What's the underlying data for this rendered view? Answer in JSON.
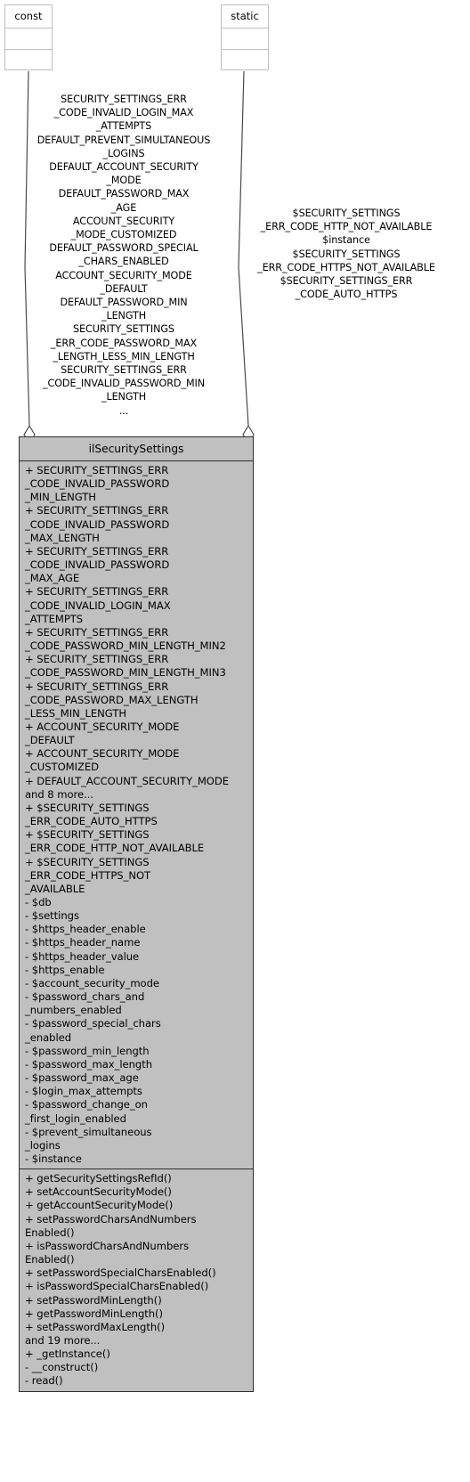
{
  "diagram": {
    "type": "uml-class-diagram",
    "background_color": "#ffffff",
    "class_fill_color": "#c0c0c0",
    "class_border_color": "#2e2e2e",
    "stereotype_box_fill": "#ffffff",
    "stereotype_box_border": "#bfbfbf",
    "edge_color": "#4a4a4a",
    "relationship": "aggregation"
  },
  "stereotype_boxes": [
    {
      "id": "const",
      "title": "const"
    },
    {
      "id": "static",
      "title": "static"
    }
  ],
  "edge_labels": {
    "const": "SECURITY_SETTINGS_ERR\n_CODE_INVALID_LOGIN_MAX\n_ATTEMPTS\nDEFAULT_PREVENT_SIMULTANEOUS\n_LOGINS\nDEFAULT_ACCOUNT_SECURITY\n_MODE\nDEFAULT_PASSWORD_MAX\n_AGE\nACCOUNT_SECURITY\n_MODE_CUSTOMIZED\nDEFAULT_PASSWORD_SPECIAL\n_CHARS_ENABLED\nACCOUNT_SECURITY_MODE\n_DEFAULT\nDEFAULT_PASSWORD_MIN\n_LENGTH\nSECURITY_SETTINGS\n_ERR_CODE_PASSWORD_MAX\n_LENGTH_LESS_MIN_LENGTH\nSECURITY_SETTINGS_ERR\n_CODE_INVALID_PASSWORD_MIN\n_LENGTH\n...",
    "static": "$SECURITY_SETTINGS\n_ERR_CODE_HTTP_NOT_AVAILABLE\n$instance\n$SECURITY_SETTINGS\n_ERR_CODE_HTTPS_NOT_AVAILABLE\n$SECURITY_SETTINGS_ERR\n_CODE_AUTO_HTTPS"
  },
  "main_class": {
    "name": "ilSecuritySettings",
    "attributes": [
      "+ SECURITY_SETTINGS_ERR\n_CODE_INVALID_PASSWORD\n_MIN_LENGTH",
      "+ SECURITY_SETTINGS_ERR\n_CODE_INVALID_PASSWORD\n_MAX_LENGTH",
      "+ SECURITY_SETTINGS_ERR\n_CODE_INVALID_PASSWORD\n_MAX_AGE",
      "+ SECURITY_SETTINGS_ERR\n_CODE_INVALID_LOGIN_MAX\n_ATTEMPTS",
      "+ SECURITY_SETTINGS_ERR\n_CODE_PASSWORD_MIN_LENGTH_MIN2",
      "+ SECURITY_SETTINGS_ERR\n_CODE_PASSWORD_MIN_LENGTH_MIN3",
      "+ SECURITY_SETTINGS_ERR\n_CODE_PASSWORD_MAX_LENGTH\n_LESS_MIN_LENGTH",
      "+ ACCOUNT_SECURITY_MODE\n_DEFAULT",
      "+ ACCOUNT_SECURITY_MODE\n_CUSTOMIZED",
      "+ DEFAULT_ACCOUNT_SECURITY_MODE",
      "and 8 more...",
      "+ $SECURITY_SETTINGS\n_ERR_CODE_AUTO_HTTPS",
      "+ $SECURITY_SETTINGS\n_ERR_CODE_HTTP_NOT_AVAILABLE",
      "+ $SECURITY_SETTINGS\n_ERR_CODE_HTTPS_NOT\n_AVAILABLE",
      "- $db",
      "- $settings",
      "- $https_header_enable",
      "- $https_header_name",
      "- $https_header_value",
      "- $https_enable",
      "- $account_security_mode",
      "- $password_chars_and\n_numbers_enabled",
      "- $password_special_chars\n_enabled",
      "- $password_min_length",
      "- $password_max_length",
      "- $password_max_age",
      "- $login_max_attempts",
      "- $password_change_on\n_first_login_enabled",
      "- $prevent_simultaneous\n_logins",
      "- $instance"
    ],
    "methods": [
      "+ getSecuritySettingsRefId()",
      "+ setAccountSecurityMode()",
      "+ getAccountSecurityMode()",
      "+ setPasswordCharsAndNumbers\nEnabled()",
      "+ isPasswordCharsAndNumbers\nEnabled()",
      "+ setPasswordSpecialCharsEnabled()",
      "+ isPasswordSpecialCharsEnabled()",
      "+ setPasswordMinLength()",
      "+ getPasswordMinLength()",
      "+ setPasswordMaxLength()",
      "and 19 more...",
      "+ _getInstance()",
      "-  __construct()",
      "- read()"
    ]
  }
}
